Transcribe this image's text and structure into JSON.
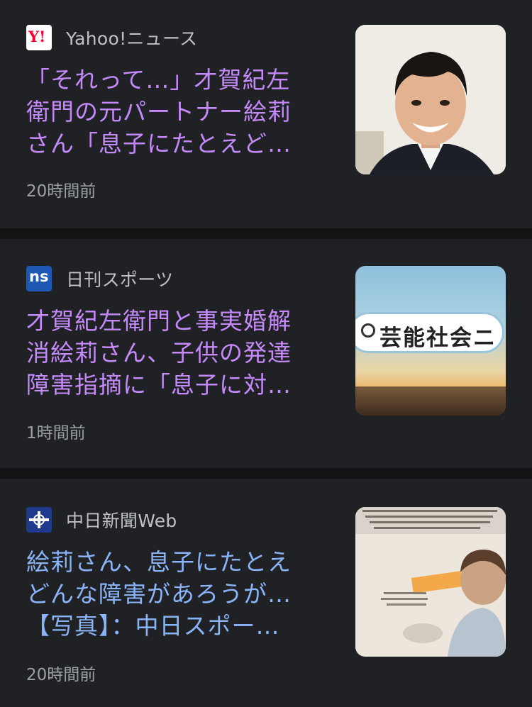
{
  "theme": {
    "bg": "#202124",
    "visited_link": "#c58af9",
    "unvisited_link": "#8ab4f8"
  },
  "articles": [
    {
      "source": "Yahoo!ニュース",
      "logo_text": "Y!",
      "headline_lines": [
        "「それって…」才賀紀左",
        "衛門の元パートナー絵莉",
        "さん「息子にたとえど…"
      ],
      "time": "20時間前",
      "link_state": "visited",
      "thumbnail_icon": "portrait-photo"
    },
    {
      "source": "日刊スポーツ",
      "logo_text": "ns",
      "headline_lines": [
        "才賀紀左衛門と事実婚解",
        "消絵莉さん、子供の発達",
        "障害指摘に「息子に対…"
      ],
      "time": "1時間前",
      "link_state": "visited",
      "thumbnail_icon": "search-banner-image",
      "thumbnail_text": "芸能社会ニ"
    },
    {
      "source": "中日新聞Web",
      "logo_text": "",
      "headline_lines": [
        "絵莉さん、息子にたとえ",
        "どんな障害があろうが…",
        "【写真】：中日スポー…"
      ],
      "time": "20時間前",
      "link_state": "unvisited",
      "thumbnail_icon": "baby-photo"
    }
  ]
}
